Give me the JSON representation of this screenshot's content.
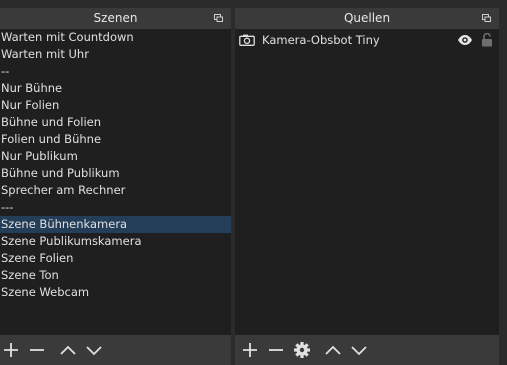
{
  "scenes": {
    "title": "Szenen",
    "items": [
      {
        "label": "Warten mit Countdown"
      },
      {
        "label": "Warten mit Uhr"
      },
      {
        "label": "--"
      },
      {
        "label": "Nur Bühne"
      },
      {
        "label": "Nur Folien"
      },
      {
        "label": "Bühne und Folien"
      },
      {
        "label": "Folien und Bühne"
      },
      {
        "label": "Nur Publikum"
      },
      {
        "label": "Bühne und Publikum"
      },
      {
        "label": "Sprecher am Rechner"
      },
      {
        "label": "---"
      },
      {
        "label": "Szene Bühnenkamera",
        "selected": true
      },
      {
        "label": "Szene Publikumskamera"
      },
      {
        "label": "Szene Folien"
      },
      {
        "label": "Szene Ton"
      },
      {
        "label": "Szene Webcam"
      }
    ],
    "toolbar": [
      "add-icon",
      "remove-icon",
      "move-up-icon",
      "move-down-icon"
    ]
  },
  "sources": {
    "title": "Quellen",
    "items": [
      {
        "label": "Kamera-Obsbot Tiny",
        "icon": "camera-icon",
        "visible": true,
        "locked": false
      }
    ],
    "toolbar": [
      "add-icon",
      "remove-icon",
      "settings-gear-icon",
      "move-up-icon",
      "move-down-icon"
    ]
  },
  "colors": {
    "panel_bg": "#1f1f1f",
    "titlebar_bg": "#3a3a3a",
    "selection": "#243e5a",
    "text": "#e0e0e0"
  }
}
